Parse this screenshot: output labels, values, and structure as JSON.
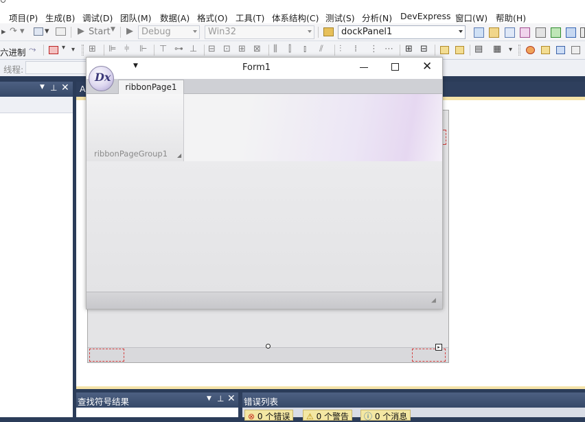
{
  "menu": {
    "items": [
      "项目(P)",
      "生成(B)",
      "调试(D)",
      "团队(M)",
      "数据(A)",
      "格式(O)",
      "工具(T)",
      "体系结构(C)",
      "测试(S)",
      "分析(N)",
      "DevExpress",
      "窗口(W)",
      "帮助(H)"
    ]
  },
  "toolbar": {
    "start_label": "Start",
    "config_value": "Debug",
    "platform_value": "Win32",
    "panel_value": "dockPanel1"
  },
  "toolbar2": {
    "hex_label": "六进制"
  },
  "toolbar3": {
    "thread_label": "线程:"
  },
  "left_panel": {
    "tab_label": "A"
  },
  "form": {
    "title": "Form1",
    "logo_text": "Dx",
    "ribbon_page": "ribbonPage1",
    "ribbon_group": "ribbonPageGroup1"
  },
  "bottom": {
    "find_symbol_title": "查找符号结果",
    "error_list_title": "错误列表",
    "errors": "0 个错误",
    "warnings": "0 个警告",
    "messages": "0 个消息"
  },
  "colors": {
    "vs_frame": "#2b3c59",
    "error_tab": "#f3e7a3",
    "dashed_selection": "#d33b3b"
  }
}
